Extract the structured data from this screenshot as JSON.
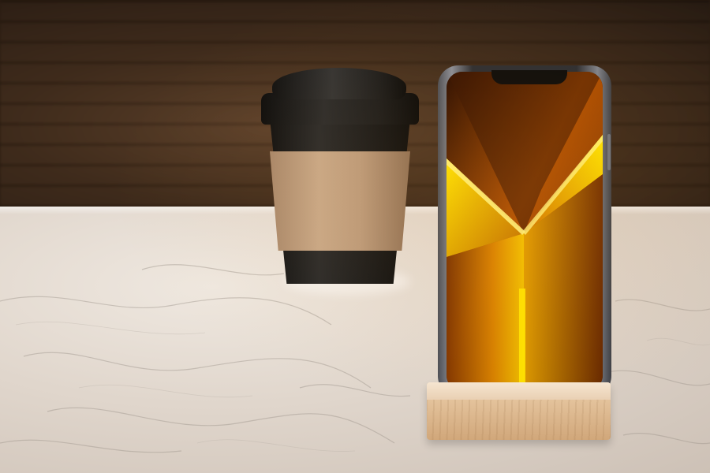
{
  "scene": {
    "subjects": [
      "coffee-cup",
      "smartphone",
      "wooden-phone-stand",
      "marble-table"
    ],
    "colors": {
      "background": "#3b2717",
      "table": "#e0d6cc",
      "cup_black": "#1a1a1a",
      "cup_sleeve": "#bb9a7b",
      "stand_wood": "#e4c39c",
      "phone_frame": "#2a2c31",
      "wallpaper_dark": "#3a1600",
      "wallpaper_amber": "#e08a00",
      "wallpaper_yellow": "#ffe600"
    }
  }
}
